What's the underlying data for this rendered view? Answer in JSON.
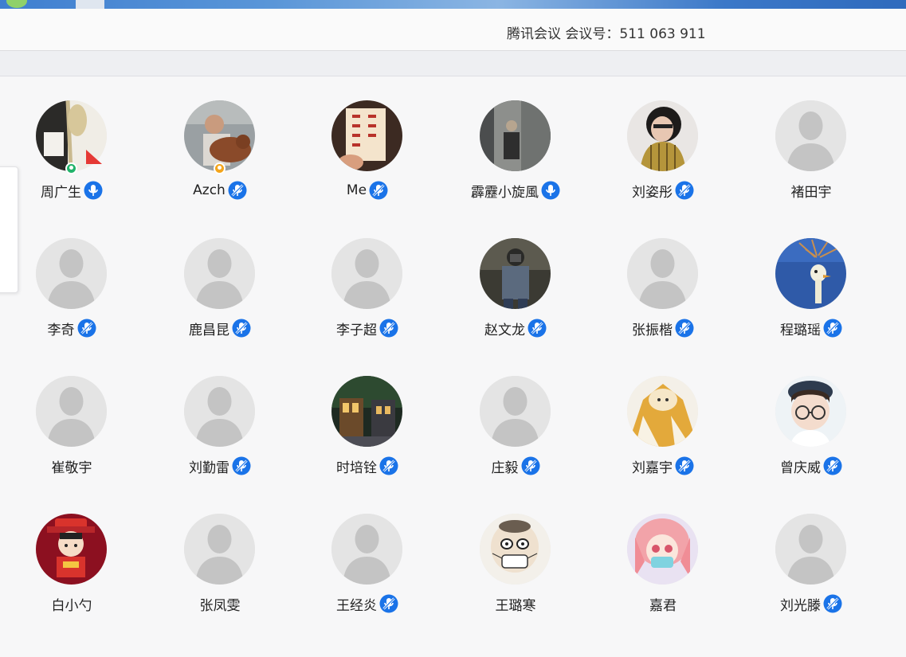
{
  "header": {
    "title": "腾讯会议 会议号：511 063 911"
  },
  "colors": {
    "accent": "#1a73e8",
    "host_badge": "#22b36b",
    "cohost_badge": "#f4a51c",
    "placeholder_avatar": "#e4e4e4"
  },
  "participants": [
    {
      "name": "周广生",
      "avatar": "photo-plant",
      "mic": "mic-on-icon",
      "badge": "host"
    },
    {
      "name": "Azch",
      "avatar": "photo-man-dog",
      "mic": "mic-muted-icon",
      "badge": "cohost"
    },
    {
      "name": "Me",
      "avatar": "photo-calligraphy",
      "mic": "mic-muted-icon",
      "badge": ""
    },
    {
      "name": "霹靂小旋風",
      "avatar": "photo-mirror-selfie",
      "mic": "mic-on-icon",
      "badge": ""
    },
    {
      "name": "刘姿彤",
      "avatar": "photo-girl-bob",
      "mic": "mic-muted-icon",
      "badge": ""
    },
    {
      "name": "褚田宇",
      "avatar": "default",
      "mic": "",
      "badge": ""
    },
    {
      "name": "李奇",
      "avatar": "default",
      "mic": "mic-muted-icon",
      "badge": ""
    },
    {
      "name": "鹿昌昆",
      "avatar": "default",
      "mic": "mic-muted-icon",
      "badge": ""
    },
    {
      "name": "李子超",
      "avatar": "default",
      "mic": "mic-muted-icon",
      "badge": ""
    },
    {
      "name": "赵文龙",
      "avatar": "photo-masked-person",
      "mic": "mic-muted-icon",
      "badge": ""
    },
    {
      "name": "张振楷",
      "avatar": "default",
      "mic": "mic-muted-icon",
      "badge": ""
    },
    {
      "name": "程璐瑶",
      "avatar": "photo-bird",
      "mic": "mic-muted-icon",
      "badge": ""
    },
    {
      "name": "崔敬宇",
      "avatar": "default",
      "mic": "",
      "badge": ""
    },
    {
      "name": "刘勤雷",
      "avatar": "default",
      "mic": "mic-muted-icon",
      "badge": ""
    },
    {
      "name": "时培铨",
      "avatar": "photo-night-street",
      "mic": "mic-muted-icon",
      "badge": ""
    },
    {
      "name": "庄毅",
      "avatar": "default",
      "mic": "mic-muted-icon",
      "badge": ""
    },
    {
      "name": "刘嘉宇",
      "avatar": "photo-anime-yellow",
      "mic": "mic-muted-icon",
      "badge": ""
    },
    {
      "name": "曾庆威",
      "avatar": "photo-child-glasses",
      "mic": "mic-muted-icon",
      "badge": ""
    },
    {
      "name": "白小勺",
      "avatar": "photo-cartoon-red",
      "mic": "",
      "badge": ""
    },
    {
      "name": "张凤雯",
      "avatar": "default",
      "mic": "",
      "badge": ""
    },
    {
      "name": "王经炎",
      "avatar": "default",
      "mic": "mic-muted-icon",
      "badge": ""
    },
    {
      "name": "王璐寒",
      "avatar": "photo-cartoon-mask",
      "mic": "",
      "badge": ""
    },
    {
      "name": "嘉君",
      "avatar": "photo-anime-pink",
      "mic": "",
      "badge": ""
    },
    {
      "name": "刘光滕",
      "avatar": "default",
      "mic": "mic-muted-icon",
      "badge": ""
    }
  ]
}
